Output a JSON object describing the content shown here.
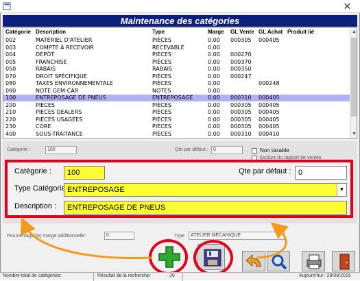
{
  "window": {
    "close_glyph": "✕"
  },
  "header": {
    "title": "Maintenance des catégories"
  },
  "table": {
    "columns": [
      "Catégorie",
      "Description",
      "Type",
      "Marge",
      "GL Vente",
      "GL Achat",
      "Produit lié"
    ],
    "rows": [
      [
        "002",
        "MATÉRIEL D'ATELIER",
        "PIÈCES",
        "0.00",
        "000305",
        "000405",
        ""
      ],
      [
        "003",
        "COMPTE À RECEVOIR",
        "RECEVABLE",
        "0.00",
        "",
        "",
        ""
      ],
      [
        "004",
        "DÉPÔT",
        "PIÈCES",
        "0.00",
        "000270",
        "",
        ""
      ],
      [
        "005",
        "FRANCHISE",
        "PIÈCES",
        "0.00",
        "000370",
        "",
        ""
      ],
      [
        "050",
        "RABAIS",
        "RABAIS",
        "0.00",
        "000350",
        "",
        ""
      ],
      [
        "070",
        "DROIT SPÉCIFIQUE",
        "PIÈCES",
        "0.00",
        "000247",
        "",
        ""
      ],
      [
        "080",
        "TAXES ENVIRONNEMENTALE",
        "PIÈCES",
        "0.00",
        "",
        "000248",
        ""
      ],
      [
        "090",
        "NOTE GEM-CAR",
        "NOTES",
        "0.00",
        "",
        "",
        ""
      ],
      [
        "100",
        "ENTREPOSAGE DE PNEUS",
        "ENTREPOSAGE",
        "0.00",
        "000310",
        "000405",
        ""
      ],
      [
        "200",
        "PIECES",
        "PIÈCES",
        "0.00",
        "000305",
        "000405",
        ""
      ],
      [
        "210",
        "PIECES DEALERS",
        "PIÈCES",
        "0.00",
        "000305",
        "000405",
        ""
      ],
      [
        "220",
        "PIÈCES USAGÉES",
        "PIÈCES",
        "0.00",
        "000305",
        "000405",
        ""
      ],
      [
        "230",
        "CORE",
        "PIÈCES",
        "0.00",
        "000305",
        "000405",
        ""
      ],
      [
        "400",
        "SOUS-TRAITANCE",
        "PIÈCES",
        "0.00",
        "000310",
        "000410",
        ""
      ]
    ],
    "selected_index": 8
  },
  "background_form": {
    "categorie_label": "Catégorie :",
    "categorie_value": "100",
    "qte_label": "Qte par défaut :",
    "qte_value": "0",
    "non_taxable_label": "Non taxable",
    "exclure_label": "Exclure du rapport de ventes",
    "marge_label": "Pourcentage(%) marge additionnelle :",
    "marge_value": "0",
    "type_label": "Type",
    "type_value": "ATELIER MÉCANIQUE"
  },
  "form": {
    "categorie_label": "Catégorie :",
    "categorie_value": "100",
    "qte_label": "Qte par défaut :",
    "qte_value": "0",
    "type_label": "Type Catégorie :",
    "type_value": "ENTREPOSAGE",
    "description_label": "Description :",
    "description_value": "ENTREPOSAGE DE PNEUS"
  },
  "statusbar": {
    "count_label": "Nombre total de catégories:",
    "search_label": "Résultat de la recherche:",
    "search_value": "29",
    "date_text": "Aujourd'hui : 29/09/2015"
  },
  "colors": {
    "header_bg": "#0c1f7a",
    "selected_row": "#b4b0f4",
    "highlight_red": "#e3001b",
    "arrow_orange": "#f29a1d",
    "field_yellow": "#ffff33",
    "add_green": "#2fa832"
  }
}
